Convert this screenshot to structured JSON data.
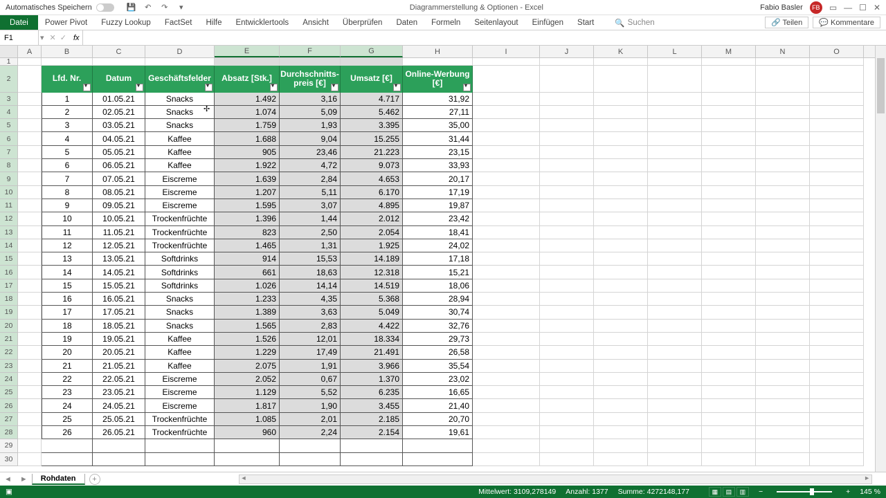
{
  "titlebar": {
    "autosave": "Automatisches Speichern",
    "doc_title": "Diagrammerstellung & Optionen  -  Excel",
    "user": "Fabio Basler",
    "avatar": "FB"
  },
  "ribbon": {
    "file": "Datei",
    "tabs": [
      "Start",
      "Einfügen",
      "Seitenlayout",
      "Formeln",
      "Daten",
      "Überprüfen",
      "Ansicht",
      "Entwicklertools",
      "Hilfe",
      "FactSet",
      "Fuzzy Lookup",
      "Power Pivot"
    ],
    "search": "Suchen",
    "share": "Teilen",
    "comments": "Kommentare"
  },
  "formula": {
    "namebox": "F1"
  },
  "cols": [
    "A",
    "B",
    "C",
    "D",
    "E",
    "F",
    "G",
    "H",
    "I",
    "J",
    "K",
    "L",
    "M",
    "N",
    "O"
  ],
  "headers": [
    "Lfd. Nr.",
    "Datum",
    "Geschäftsfelder",
    "Absatz  [Stk.]",
    "Durchschnitts-\npreis [€]",
    "Umsatz [€]",
    "Online-Werbung [€]"
  ],
  "rows": [
    {
      "n": "1",
      "d": "01.05.21",
      "g": "Snacks",
      "a": "1.492",
      "p": "3,16",
      "u": "4.717",
      "o": "31,92"
    },
    {
      "n": "2",
      "d": "02.05.21",
      "g": "Snacks",
      "a": "1.074",
      "p": "5,09",
      "u": "5.462",
      "o": "27,11"
    },
    {
      "n": "3",
      "d": "03.05.21",
      "g": "Snacks",
      "a": "1.759",
      "p": "1,93",
      "u": "3.395",
      "o": "35,00"
    },
    {
      "n": "4",
      "d": "04.05.21",
      "g": "Kaffee",
      "a": "1.688",
      "p": "9,04",
      "u": "15.255",
      "o": "31,44"
    },
    {
      "n": "5",
      "d": "05.05.21",
      "g": "Kaffee",
      "a": "905",
      "p": "23,46",
      "u": "21.223",
      "o": "23,15"
    },
    {
      "n": "6",
      "d": "06.05.21",
      "g": "Kaffee",
      "a": "1.922",
      "p": "4,72",
      "u": "9.073",
      "o": "33,93"
    },
    {
      "n": "7",
      "d": "07.05.21",
      "g": "Eiscreme",
      "a": "1.639",
      "p": "2,84",
      "u": "4.653",
      "o": "20,17"
    },
    {
      "n": "8",
      "d": "08.05.21",
      "g": "Eiscreme",
      "a": "1.207",
      "p": "5,11",
      "u": "6.170",
      "o": "17,19"
    },
    {
      "n": "9",
      "d": "09.05.21",
      "g": "Eiscreme",
      "a": "1.595",
      "p": "3,07",
      "u": "4.895",
      "o": "19,87"
    },
    {
      "n": "10",
      "d": "10.05.21",
      "g": "Trockenfrüchte",
      "a": "1.396",
      "p": "1,44",
      "u": "2.012",
      "o": "23,42"
    },
    {
      "n": "11",
      "d": "11.05.21",
      "g": "Trockenfrüchte",
      "a": "823",
      "p": "2,50",
      "u": "2.054",
      "o": "18,41"
    },
    {
      "n": "12",
      "d": "12.05.21",
      "g": "Trockenfrüchte",
      "a": "1.465",
      "p": "1,31",
      "u": "1.925",
      "o": "24,02"
    },
    {
      "n": "13",
      "d": "13.05.21",
      "g": "Softdrinks",
      "a": "914",
      "p": "15,53",
      "u": "14.189",
      "o": "17,18"
    },
    {
      "n": "14",
      "d": "14.05.21",
      "g": "Softdrinks",
      "a": "661",
      "p": "18,63",
      "u": "12.318",
      "o": "15,21"
    },
    {
      "n": "15",
      "d": "15.05.21",
      "g": "Softdrinks",
      "a": "1.026",
      "p": "14,14",
      "u": "14.519",
      "o": "18,06"
    },
    {
      "n": "16",
      "d": "16.05.21",
      "g": "Snacks",
      "a": "1.233",
      "p": "4,35",
      "u": "5.368",
      "o": "28,94"
    },
    {
      "n": "17",
      "d": "17.05.21",
      "g": "Snacks",
      "a": "1.389",
      "p": "3,63",
      "u": "5.049",
      "o": "30,74"
    },
    {
      "n": "18",
      "d": "18.05.21",
      "g": "Snacks",
      "a": "1.565",
      "p": "2,83",
      "u": "4.422",
      "o": "32,76"
    },
    {
      "n": "19",
      "d": "19.05.21",
      "g": "Kaffee",
      "a": "1.526",
      "p": "12,01",
      "u": "18.334",
      "o": "29,73"
    },
    {
      "n": "20",
      "d": "20.05.21",
      "g": "Kaffee",
      "a": "1.229",
      "p": "17,49",
      "u": "21.491",
      "o": "26,58"
    },
    {
      "n": "21",
      "d": "21.05.21",
      "g": "Kaffee",
      "a": "2.075",
      "p": "1,91",
      "u": "3.966",
      "o": "35,54"
    },
    {
      "n": "22",
      "d": "22.05.21",
      "g": "Eiscreme",
      "a": "2.052",
      "p": "0,67",
      "u": "1.370",
      "o": "23,02"
    },
    {
      "n": "23",
      "d": "23.05.21",
      "g": "Eiscreme",
      "a": "1.129",
      "p": "5,52",
      "u": "6.235",
      "o": "16,65"
    },
    {
      "n": "24",
      "d": "24.05.21",
      "g": "Eiscreme",
      "a": "1.817",
      "p": "1,90",
      "u": "3.455",
      "o": "21,40"
    },
    {
      "n": "25",
      "d": "25.05.21",
      "g": "Trockenfrüchte",
      "a": "1.085",
      "p": "2,01",
      "u": "2.185",
      "o": "20,70"
    },
    {
      "n": "26",
      "d": "26.05.21",
      "g": "Trockenfrüchte",
      "a": "960",
      "p": "2,24",
      "u": "2.154",
      "o": "19,61"
    }
  ],
  "sheet": {
    "name": "Rohdaten"
  },
  "status": {
    "avg_label": "Mittelwert:",
    "avg": "3109,278149",
    "count_label": "Anzahl:",
    "count": "1377",
    "sum_label": "Summe:",
    "sum": "4272148,177",
    "zoom": "145 %"
  }
}
